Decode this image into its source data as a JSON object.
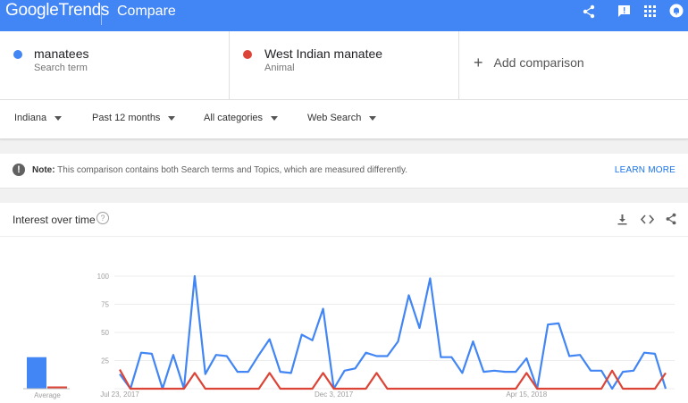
{
  "header": {
    "logo_google": "Google",
    "logo_trends": "Trends",
    "page_title": "Compare",
    "icons": [
      "share-icon",
      "feedback-icon",
      "apps-icon",
      "notifications-icon"
    ]
  },
  "terms": [
    {
      "name": "manatees",
      "type": "Search term",
      "color": "#4285f4"
    },
    {
      "name": "West Indian manatee",
      "type": "Animal",
      "color": "#db4437"
    }
  ],
  "add_comparison": "Add comparison",
  "filters": {
    "region": "Indiana",
    "time": "Past 12 months",
    "category": "All categories",
    "property": "Web Search"
  },
  "note": {
    "label": "Note:",
    "text": "This comparison contains both Search terms and Topics, which are measured differently.",
    "link": "LEARN MORE"
  },
  "panel": {
    "title": "Interest over time",
    "help": "?",
    "icons": [
      "download-icon",
      "embed-icon",
      "share-icon"
    ]
  },
  "chart_data": {
    "type": "line",
    "title": "Interest over time",
    "ylim": [
      0,
      100
    ],
    "yticks": [
      0,
      25,
      50,
      75,
      100
    ],
    "x_tick_labels": [
      "Jul 23, 2017",
      "Dec 3, 2017",
      "Apr 15, 2018"
    ],
    "x_tick_index": [
      0,
      20,
      38
    ],
    "grid": true,
    "series": [
      {
        "name": "manatees",
        "color": "#4285f4",
        "values": [
          13,
          0,
          32,
          31,
          0,
          30,
          0,
          100,
          13,
          30,
          29,
          15,
          15,
          30,
          44,
          15,
          14,
          48,
          43,
          71,
          0,
          16,
          18,
          32,
          29,
          29,
          42,
          83,
          54,
          98,
          28,
          28,
          14,
          42,
          15,
          16,
          15,
          15,
          27,
          0,
          57,
          58,
          29,
          30,
          16,
          16,
          0,
          15,
          16,
          32,
          31,
          0
        ]
      },
      {
        "name": "West Indian manatee",
        "color": "#db4437",
        "values": [
          17,
          0,
          0,
          0,
          0,
          0,
          0,
          14,
          0,
          0,
          0,
          0,
          0,
          0,
          14,
          0,
          0,
          0,
          0,
          14,
          0,
          0,
          0,
          0,
          14,
          0,
          0,
          0,
          0,
          0,
          0,
          0,
          0,
          0,
          0,
          0,
          0,
          0,
          14,
          0,
          0,
          0,
          0,
          0,
          0,
          0,
          16,
          0,
          0,
          0,
          0,
          14
        ]
      }
    ],
    "average": {
      "label": "Average",
      "values": [
        28,
        2
      ]
    }
  }
}
